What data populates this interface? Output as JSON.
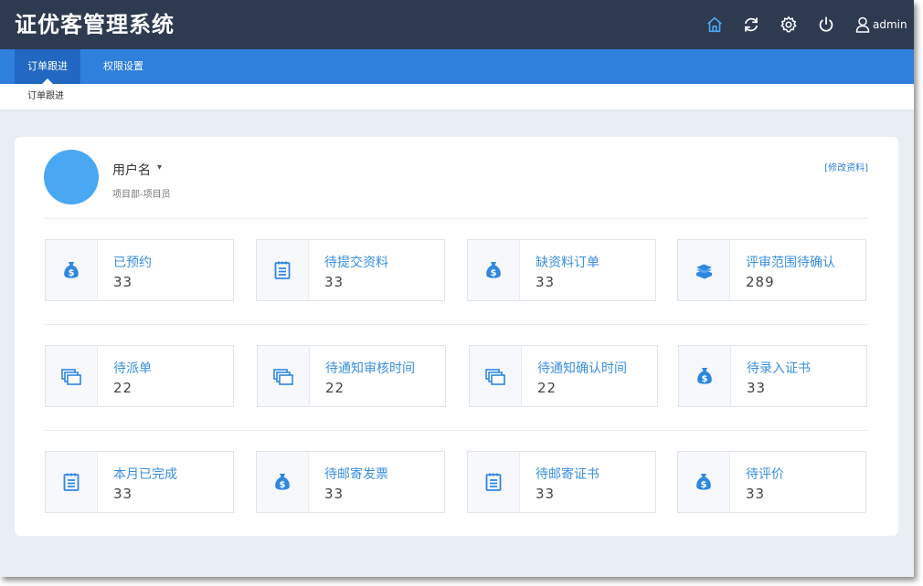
{
  "header": {
    "app_title": "证优客管理系统",
    "icons": [
      "home-icon",
      "refresh-icon",
      "gear-icon",
      "power-icon",
      "user-icon"
    ],
    "username": "admin",
    "accent_active_icon": "#4aa8f2"
  },
  "nav": {
    "tabs": [
      {
        "label": "订单跟进",
        "active": true
      },
      {
        "label": "权限设置",
        "active": false
      }
    ]
  },
  "breadcrumb": {
    "current": "订单跟进"
  },
  "profile": {
    "name": "用户名",
    "caret": "▾",
    "department": "项目部-项目员",
    "edit_link": "[修改资料]"
  },
  "stats": [
    {
      "label": "已预约",
      "count": "33",
      "icon": "money-bag-icon"
    },
    {
      "label": "待提交资料",
      "count": "33",
      "icon": "notepad-icon"
    },
    {
      "label": "缺资料订单",
      "count": "33",
      "icon": "money-bag-icon"
    },
    {
      "label": "评审范围待确认",
      "count": "289",
      "icon": "stack-icon"
    },
    {
      "label": "待派单",
      "count": "22",
      "icon": "cards-icon"
    },
    {
      "label": "待通知审核时间",
      "count": "22",
      "icon": "cards-icon"
    },
    {
      "label": "待通知确认时间",
      "count": "22",
      "icon": "cards-icon"
    },
    {
      "label": "待录入证书",
      "count": "33",
      "icon": "money-bag-icon"
    },
    {
      "label": "本月已完成",
      "count": "33",
      "icon": "notepad-icon"
    },
    {
      "label": "待邮寄发票",
      "count": "33",
      "icon": "money-bag-icon"
    },
    {
      "label": "待邮寄证书",
      "count": "33",
      "icon": "notepad-icon"
    },
    {
      "label": "待评价",
      "count": "33",
      "icon": "money-bag-icon"
    }
  ],
  "colors": {
    "topbar": "#2e3a50",
    "navbar": "#2f7fdc",
    "accent": "#3a8fdf",
    "background": "#e9edf4"
  }
}
